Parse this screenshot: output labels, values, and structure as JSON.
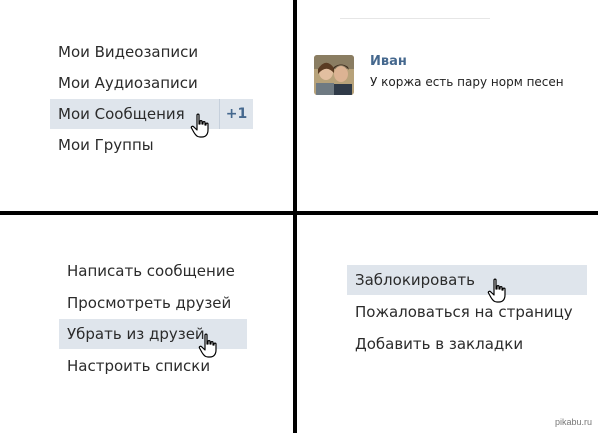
{
  "panel_top_left": {
    "items": [
      {
        "label": "Мои Видеозаписи"
      },
      {
        "label": "Мои Аудиозаписи"
      },
      {
        "label": "Мои Сообщения",
        "badge": "+1"
      },
      {
        "label": "Мои Группы"
      }
    ]
  },
  "panel_top_right": {
    "message": {
      "sender": "Иван",
      "text": "У коржа есть пару норм песен"
    }
  },
  "panel_bottom_left": {
    "items": [
      {
        "label": "Написать сообщение"
      },
      {
        "label": "Просмотреть друзей"
      },
      {
        "label": "Убрать из друзей"
      },
      {
        "label": "Настроить списки"
      }
    ]
  },
  "panel_bottom_right": {
    "items": [
      {
        "label": "Заблокировать"
      },
      {
        "label": "Пожаловаться на страницу"
      },
      {
        "label": "Добавить в закладки"
      }
    ]
  },
  "watermark": "pikabu.ru",
  "colors": {
    "highlight": "#dfe5ec",
    "link_blue": "#45688e"
  },
  "icons": [
    "hand-pointer-icon",
    "avatar-photo"
  ]
}
